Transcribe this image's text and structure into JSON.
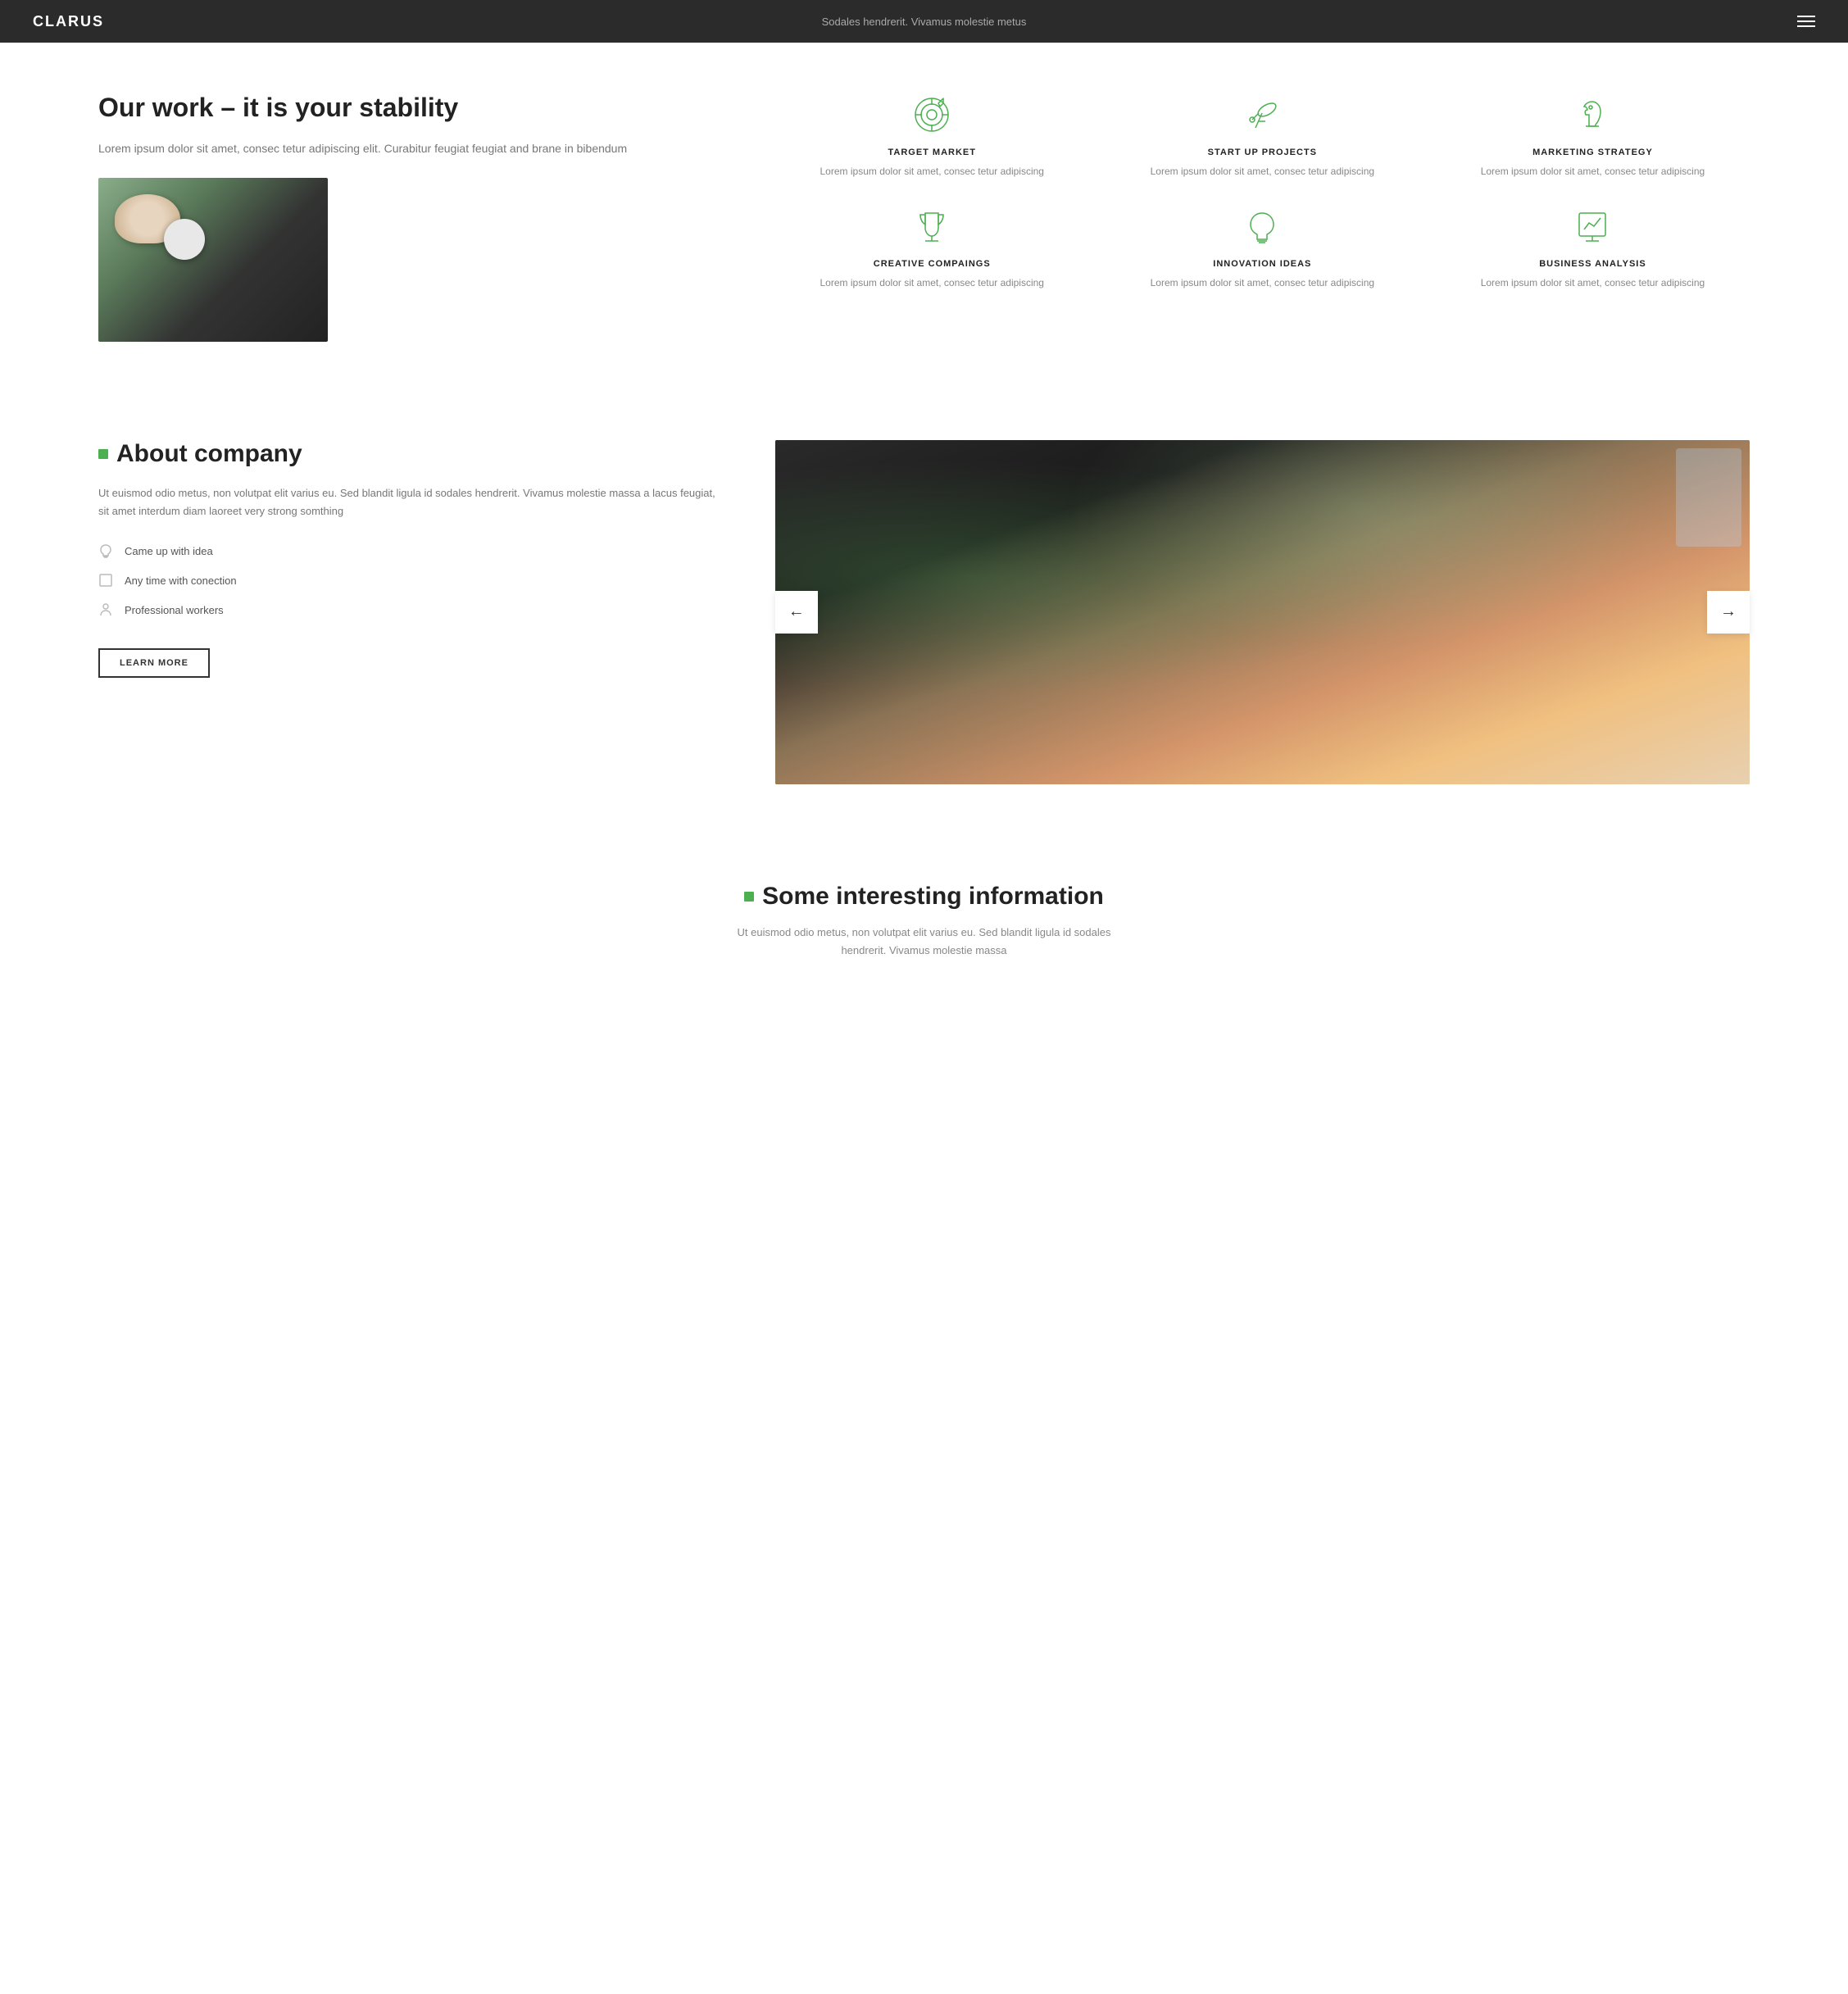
{
  "navbar": {
    "logo": "CLARUS",
    "center_text": "Sodales hendrerit. Vivamus molestie metus",
    "menu_icon": "hamburger-menu"
  },
  "section_work": {
    "title": "Our work – it is your stability",
    "description": "Lorem ipsum dolor sit amet, consec tetur adipiscing elit. Curabitur feugiat feugiat and brane in bibendum",
    "features": [
      {
        "id": "target-market",
        "title": "TARGET MARKET",
        "description": "Lorem ipsum dolor sit amet, consec tetur adipiscing",
        "icon": "target"
      },
      {
        "id": "start-up-projects",
        "title": "START UP PROJECTS",
        "description": "Lorem ipsum dolor sit amet, consec tetur adipiscing",
        "icon": "telescope"
      },
      {
        "id": "marketing-strategy",
        "title": "MARKETING STRATEGY",
        "description": "Lorem ipsum dolor sit amet, consec tetur adipiscing",
        "icon": "chess-knight"
      },
      {
        "id": "creative-campaigns",
        "title": "CREATIVE COMPAINGS",
        "description": "Lorem ipsum dolor sit amet, consec tetur adipiscing",
        "icon": "trophy"
      },
      {
        "id": "innovation-ideas",
        "title": "INNOVATION IDEAS",
        "description": "Lorem ipsum dolor sit amet, consec tetur adipiscing",
        "icon": "lightbulb"
      },
      {
        "id": "business-analysis",
        "title": "BUSINESS ANALYSIS",
        "description": "Lorem ipsum dolor sit amet, consec tetur adipiscing",
        "icon": "chart"
      }
    ]
  },
  "section_about": {
    "title": "About company",
    "description": "Ut euismod odio metus, non volutpat elit varius eu. Sed blandit ligula id sodales hendrerit. Vivamus molestie massa a lacus feugiat, sit amet interdum diam laoreet very strong somthing",
    "list_items": [
      {
        "icon": "lightbulb",
        "text": "Came up with idea"
      },
      {
        "icon": "square",
        "text": "Any time with conection"
      },
      {
        "icon": "person",
        "text": "Professional workers"
      }
    ],
    "button_label": "LEARN MORE",
    "prev_label": "←",
    "next_label": "→"
  },
  "section_info": {
    "title": "Some interesting information",
    "description": "Ut euismod odio metus, non volutpat elit varius eu. Sed blandit ligula id sodales hendrerit. Vivamus molestie massa"
  }
}
